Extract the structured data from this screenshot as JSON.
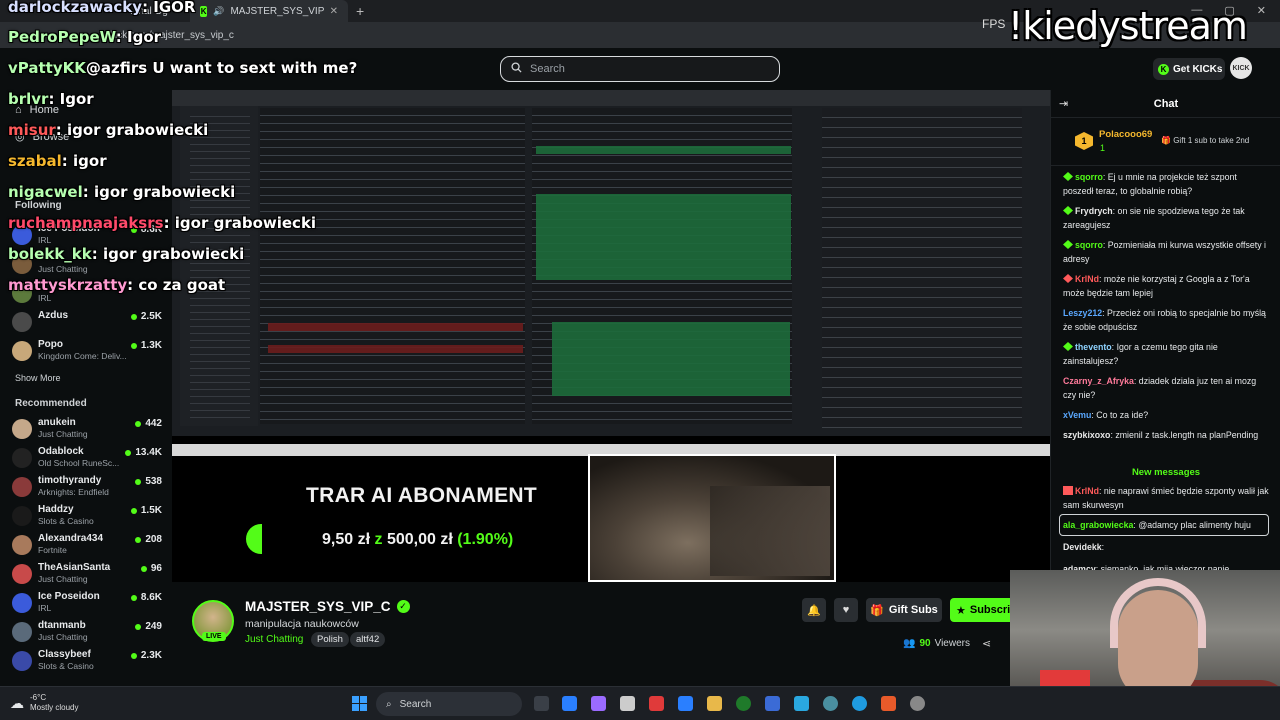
{
  "browser": {
    "tabs": [
      {
        "label": "...nal Og"
      },
      {
        "label": "MAJSTER_SYS_VIP_C Stream"
      }
    ],
    "url": "kick.com/majster_sys_vip_c",
    "new_tab": "+",
    "window_controls": [
      "—",
      "▢",
      "✕"
    ]
  },
  "header": {
    "search_placeholder": "Search",
    "get_kicks_label": "Get KICKs",
    "avatar_text": "KICK"
  },
  "sidebar": {
    "nav": [
      {
        "label": "Home",
        "icon": "home-icon"
      },
      {
        "label": "Browse",
        "icon": "compass-icon"
      }
    ],
    "following_title": "Following",
    "following": [
      {
        "name": "Ice Poseidon",
        "category": "IRL",
        "viewers": "8.6K",
        "color": "#3b5bdb"
      },
      {
        "name": "",
        "category": "Just Chatting",
        "viewers": "",
        "color": "#7a5c3c"
      },
      {
        "name": "",
        "category": "IRL",
        "viewers": "",
        "color": "#5c7a3c"
      },
      {
        "name": "Azdus",
        "category": "",
        "viewers": "2.5K",
        "color": "#4a4a4a"
      },
      {
        "name": "Popo",
        "category": "Kingdom Come: Deliv...",
        "viewers": "1.3K",
        "color": "#c8a87a"
      }
    ],
    "show_more": "Show More",
    "recommended_title": "Recommended",
    "recommended": [
      {
        "name": "anukein",
        "category": "Just Chatting",
        "viewers": "442",
        "color": "#c5a88a"
      },
      {
        "name": "Odablock",
        "category": "Old School RuneSc...",
        "viewers": "13.4K",
        "color": "#222"
      },
      {
        "name": "timothyrandy",
        "category": "Arknights: Endfield",
        "viewers": "538",
        "color": "#8a3a3a"
      },
      {
        "name": "Haddzy",
        "category": "Slots & Casino",
        "viewers": "1.5K",
        "color": "#1a1a1a"
      },
      {
        "name": "Alexandra434",
        "category": "Fortnite",
        "viewers": "208",
        "color": "#a87a5c"
      },
      {
        "name": "TheAsianSanta",
        "category": "Just Chatting",
        "viewers": "96",
        "color": "#c84a4a"
      },
      {
        "name": "Ice Poseidon",
        "category": "IRL",
        "viewers": "8.6K",
        "color": "#3b5bdb"
      },
      {
        "name": "dtanmanb",
        "category": "Just Chatting",
        "viewers": "249",
        "color": "#5a6a7a"
      },
      {
        "name": "Classybeef",
        "category": "Slots & Casino",
        "viewers": "2.3K",
        "color": "#3a4aa8"
      }
    ]
  },
  "overlay_chat": [
    {
      "user": "darlockzawacky",
      "text": ": IGOR"
    },
    {
      "user": "PedroPepeW",
      "text": ": Igor"
    },
    {
      "user": "vPattyKK",
      "text": "@azfirs U want to sext with me?"
    },
    {
      "user": "brlvr",
      "text": ": Igor"
    },
    {
      "user": "misur",
      "text": ": igor grabowiecki"
    },
    {
      "user": "szabal",
      "text": ": igor"
    },
    {
      "user": "nigacwel",
      "text": ": igor grabowiecki"
    },
    {
      "user": "ruchampnaajaksrs",
      "text": ": igor grabowiecki"
    },
    {
      "user": "bolekk_kk",
      "text": ": igor grabowiecki"
    },
    {
      "user": "mattyskrzatty",
      "text": ": co za goat"
    }
  ],
  "overlay_brand": "!kiedystream",
  "overlay_fps": "FPS",
  "stream_overlay": {
    "banner_title": "TRAR AI ABONAMENT",
    "amount_current": "9,50 zł",
    "amount_sep": "z",
    "amount_goal": "500,00 zł",
    "amount_pct": "(1.90%)",
    "progress_fraction": 0.019
  },
  "stream": {
    "streamer": "MAJSTER_SYS_VIP_C",
    "live_label": "LIVE",
    "title": "manipulacja naukowców",
    "category": "Just Chatting",
    "tags": [
      "Polish",
      "altf42"
    ],
    "gift_subs_label": "Gift Subs",
    "subscribe_label": "Subscri",
    "viewers_count": "90",
    "viewers_label": "Viewers"
  },
  "chat": {
    "title": "Chat",
    "pinned_user": "Polacooo69",
    "pinned_count": "1",
    "pinned_badge_number": "1",
    "pinned_gift_text": "Gift 1 sub to take 2nd",
    "messages": [
      {
        "user": "sqorro",
        "color": "#53fc18",
        "text": "Ej u mnie na projekcie też szpont poszedł teraz, to globalnie robią?",
        "badge": "diamond"
      },
      {
        "user": "Frydrych",
        "color": "#e9e9e9",
        "text": "on sie nie spodziewa tego że tak zareagujesz",
        "badge": "diamond"
      },
      {
        "user": "sqorro",
        "color": "#53fc18",
        "text": "Pozmieniała mi kurwa wszystkie offsety i adresy",
        "badge": "diamond"
      },
      {
        "user": "KrlNd",
        "color": "#ff5a5a",
        "text": "może nie korzystaj z Googla a z Tor'a może będzie tam lepiej",
        "badge": "pixel"
      },
      {
        "user": "Leszy212",
        "color": "#5aa8ff",
        "text": "Przecież oni robią to specjalnie bo myślą że sobie odpuścisz",
        "badge": ""
      },
      {
        "user": "thevento",
        "color": "#8fd3ff",
        "text": "Igor a czemu tego gita nie zainstalujesz?",
        "badge": "diamond"
      },
      {
        "user": "Czarny_z_Afryka",
        "color": "#ff7a9a",
        "text": "dziadek dziala juz ten ai mozg czy nie?",
        "badge": ""
      },
      {
        "user": "xVemu",
        "color": "#5aa8ff",
        "text": "Co to za ide?",
        "badge": ""
      },
      {
        "user": "szybkixoxo",
        "color": "#e9e9e9",
        "text": "zmienil z task.length na planPending",
        "badge": ""
      }
    ],
    "new_messages_label": "New messages",
    "after_messages": [
      {
        "user": "KrlNd",
        "color": "#ff5a5a",
        "text": "nie naprawi śmieć będzie szponty walił jak sam skurwesyn",
        "badge": "pixel"
      },
      {
        "user": "ala_grabowiecka",
        "color": "#53fc18",
        "text": "@adamcy plac alimenty huju",
        "badge": ""
      },
      {
        "user": "Devidekk",
        "color": "#e9e9e9",
        "text": "",
        "badge": ""
      },
      {
        "user": "adamcy",
        "color": "#e9e9e9",
        "text": "siemanko, jak mija wieczor panie",
        "badge": ""
      }
    ]
  },
  "taskbar": {
    "weather_temp": "-6°C",
    "weather_desc": "Mostly cloudy",
    "search_label": "Search"
  }
}
